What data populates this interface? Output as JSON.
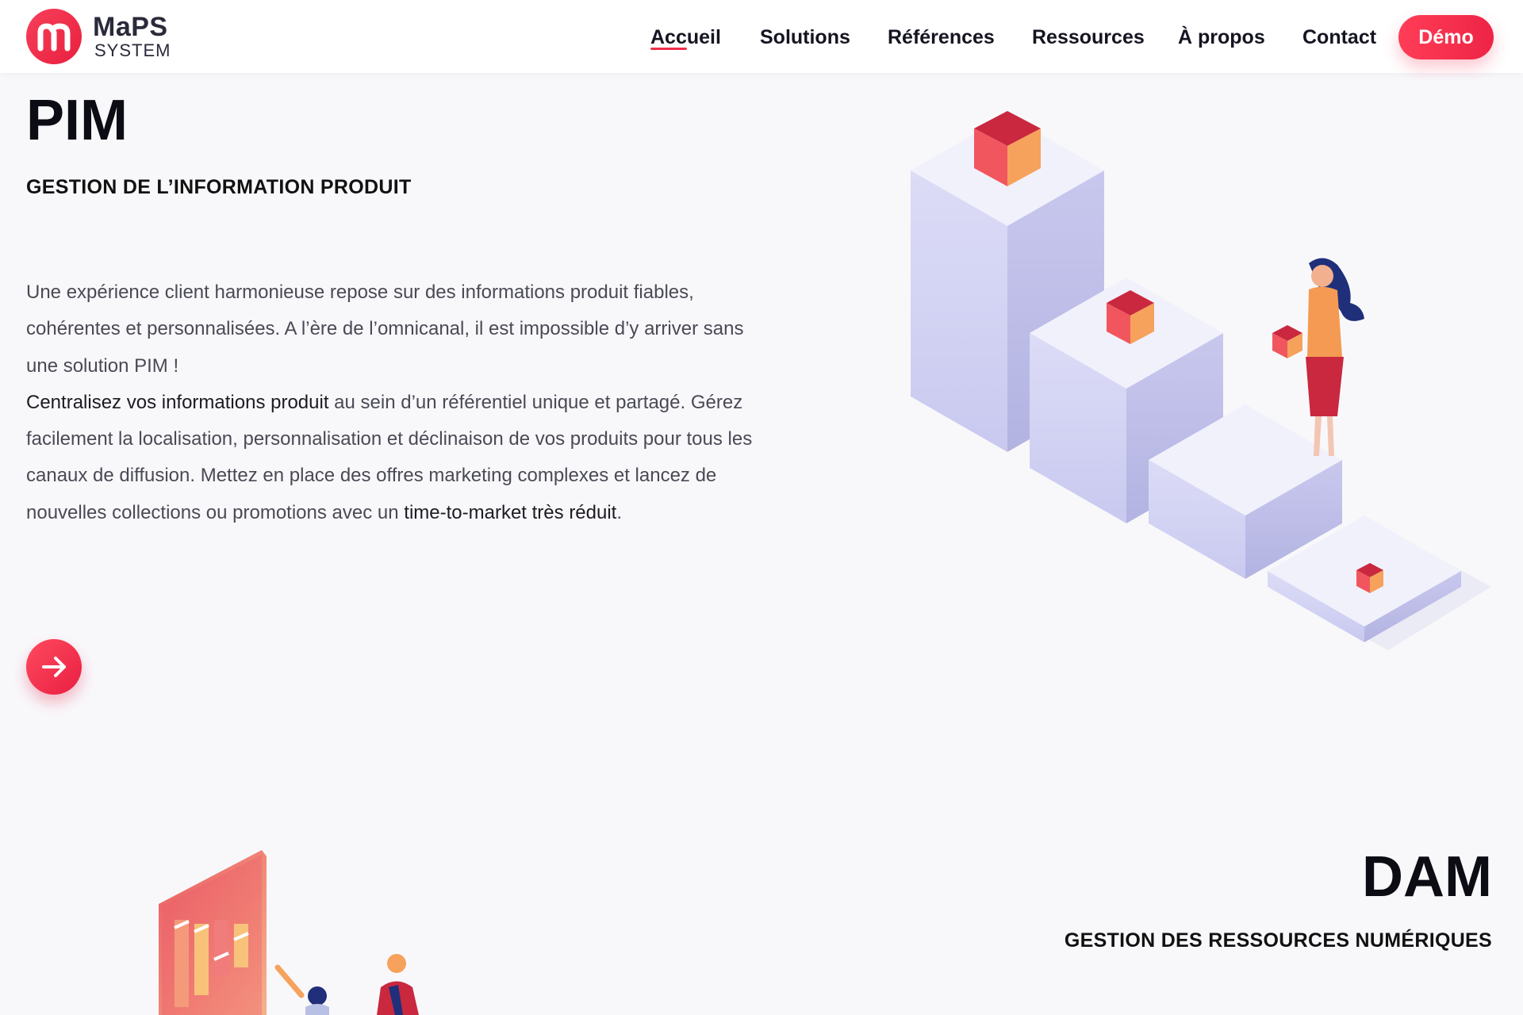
{
  "header": {
    "logo": {
      "word": "MaPS",
      "sub": "SYSTEM"
    },
    "nav": [
      {
        "label": "Accueil",
        "active": true
      },
      {
        "label": "Solutions"
      },
      {
        "label": "Références"
      },
      {
        "label": "Ressources"
      },
      {
        "label": "À propos"
      },
      {
        "label": "Contact"
      }
    ],
    "demo_label": "Démo"
  },
  "pim": {
    "title": "PIM",
    "subtitle": "GESTION DE L’INFORMATION PRODUIT",
    "intro": "Une expérience client harmonieuse repose sur des informations produit fiables, cohérentes et personnalisées. A l’ère de l’omnicanal, il est impossible d’y arriver sans une solution PIM !",
    "bold_lead": "Centralisez vos informations produit",
    "body_mid": " au sein d’un référentiel unique et partagé. Gérez facilement la localisation, personnalisation et déclinaison de vos produits pour tous les canaux de diffusion. Mettez en place des offres marketing complexes et lancez de nouvelles collections ou promotions avec un ",
    "bold_tail": "time-to-market très réduit",
    "body_end": "."
  },
  "dam": {
    "title": "DAM",
    "subtitle": "GESTION DES RESSOURCES NUMÉRIQUES"
  },
  "colors": {
    "accent": "#EE2446",
    "text_dark": "#111111",
    "text_body": "#4A4A55",
    "bg": "#F8F8FB"
  },
  "icons": {
    "logo": "maps-logo-icon",
    "arrow": "arrow-right-icon"
  }
}
